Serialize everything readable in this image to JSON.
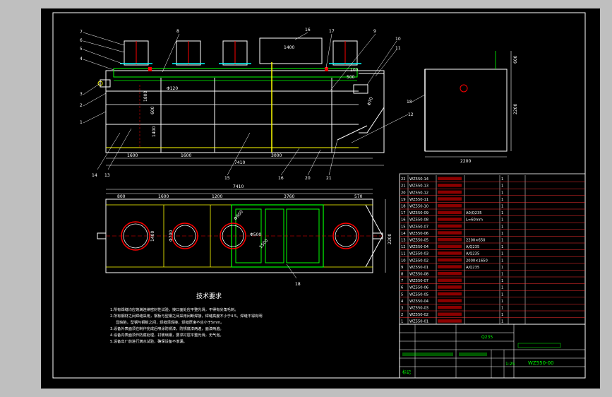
{
  "sheet": {
    "background": "#000000",
    "frame_color": "#ffffff",
    "accent_green": "#00ff00",
    "accent_yellow": "#ffff00",
    "accent_red": "#ff0000",
    "accent_cyan": "#00ffff"
  },
  "front_view": {
    "callouts_left": [
      "7",
      "6",
      "5",
      "4",
      "3",
      "2",
      "1"
    ],
    "callouts_top": [
      "8",
      "16",
      "17",
      "9",
      "10",
      "11"
    ],
    "callouts_bottom": [
      "14",
      "13",
      "15",
      "16",
      "20",
      "21"
    ],
    "callouts_right": [
      "12"
    ],
    "dims_bottom": [
      "1600",
      "1600",
      "3000",
      "7410"
    ],
    "dims_inner": [
      "Φ120",
      "1400",
      "500",
      "100"
    ],
    "dims_vertical": [
      "1800",
      "600",
      "1400",
      "Φ70"
    ]
  },
  "side_view": {
    "callout": "18",
    "dims": [
      "2200",
      "2200",
      "600"
    ]
  },
  "plan_view": {
    "dims_top": [
      "800",
      "1600",
      "1200",
      "3760",
      "570"
    ],
    "total_length": "7410",
    "dims_inner": [
      "1400",
      "Φ700",
      "Φ900",
      "Φ500",
      "1500"
    ],
    "callout": "18",
    "height_dim": "2200"
  },
  "tech_notes": {
    "title": "技术要求",
    "lines": [
      "1.所有焊缝均应饱满连续密封性试验，接口面处应平整光滑，不得有尖角毛刺。",
      "2.所有钢材之间焊缝采用，钢板与型钢之间采用间断焊接，焊缝高度不小于4.5。焊缝不得有明",
      "显缺陷，型钢与钢板之间，焊缝须焊接，焊缝厚度不应小于5mm。",
      "3.设备外表面须在制作完成后喷涂防锈漆，防锈底漆两遍，面漆两遍。",
      "4.设备内表面须作防腐处理，衬玻璃钢，要求衬层平整光滑，无气泡。",
      "5.设备出厂前进行满水试验，确保设备不渗漏。"
    ]
  },
  "parts_list": {
    "rows": [
      {
        "no": "22",
        "code": "WZ550-14",
        "name": "",
        "spec": "",
        "qty": "1"
      },
      {
        "no": "21",
        "code": "WZ550-13",
        "name": "",
        "spec": "",
        "qty": "1"
      },
      {
        "no": "20",
        "code": "WZ550-12",
        "name": "",
        "spec": "",
        "qty": "1"
      },
      {
        "no": "19",
        "code": "WZ550-11",
        "name": "",
        "spec": "",
        "qty": "1"
      },
      {
        "no": "18",
        "code": "WZ550-10",
        "name": "",
        "spec": "",
        "qty": "1"
      },
      {
        "no": "17",
        "code": "WZ550-09",
        "name": "",
        "spec": "A0/Q235",
        "qty": "1"
      },
      {
        "no": "16",
        "code": "WZ550-08",
        "name": "",
        "spec": "L=60mm",
        "qty": "1"
      },
      {
        "no": "15",
        "code": "WZ550-07",
        "name": "",
        "spec": "",
        "qty": "1"
      },
      {
        "no": "14",
        "code": "WZ550-06",
        "name": "",
        "spec": "",
        "qty": "1"
      },
      {
        "no": "13",
        "code": "WZ550-05",
        "name": "",
        "spec": "2200×650",
        "qty": "1"
      },
      {
        "no": "12",
        "code": "WZ550-04",
        "name": "",
        "spec": "A/Q235",
        "qty": "1"
      },
      {
        "no": "11",
        "code": "WZ550-03",
        "name": "",
        "spec": "A/Q235",
        "qty": "1"
      },
      {
        "no": "10",
        "code": "WZ550-02",
        "name": "",
        "spec": "2000×1650",
        "qty": "1"
      },
      {
        "no": "9",
        "code": "WZ550-01",
        "name": "",
        "spec": "A/Q235",
        "qty": "1"
      },
      {
        "no": "8",
        "code": "WZ550-08",
        "name": "",
        "spec": "",
        "qty": "1"
      },
      {
        "no": "7",
        "code": "WZ550-07",
        "name": "",
        "spec": "",
        "qty": "1"
      },
      {
        "no": "6",
        "code": "WZ550-06",
        "name": "",
        "spec": "",
        "qty": "1"
      },
      {
        "no": "5",
        "code": "WZ550-05",
        "name": "",
        "spec": "",
        "qty": "1"
      },
      {
        "no": "4",
        "code": "WZ550-04",
        "name": "",
        "spec": "",
        "qty": "1"
      },
      {
        "no": "3",
        "code": "WZ550-03",
        "name": "",
        "spec": "",
        "qty": "1"
      },
      {
        "no": "2",
        "code": "WZ550-02",
        "name": "",
        "spec": "",
        "qty": "1"
      },
      {
        "no": "1",
        "code": "WZ550-01",
        "name": "",
        "spec": "",
        "qty": "1"
      }
    ]
  },
  "title_block": {
    "material": "Q235",
    "scale": "1:25",
    "drawing_no": "WZ550-00",
    "label_pt": "标记"
  }
}
